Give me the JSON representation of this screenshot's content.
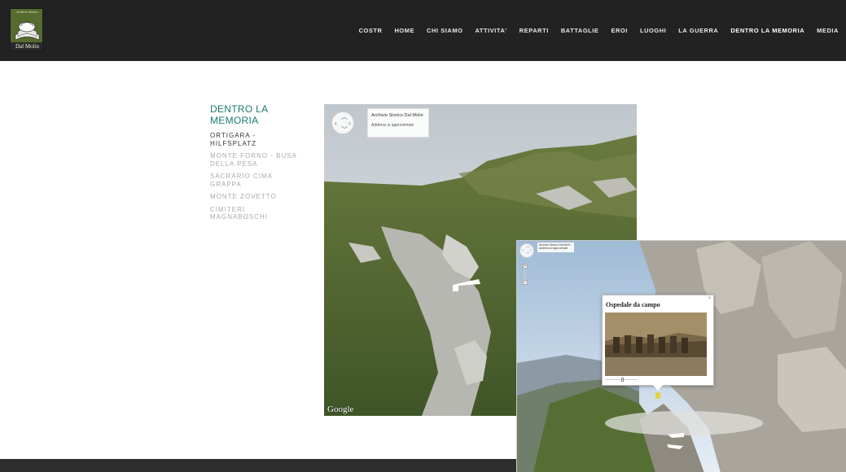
{
  "header": {
    "logo": {
      "top_text": "Archivio Storico",
      "bottom_text": "Dal Molin"
    },
    "nav": [
      {
        "label": "COSTR",
        "active": false
      },
      {
        "label": "HOME",
        "active": false
      },
      {
        "label": "CHI SIAMO",
        "active": false
      },
      {
        "label": "ATTIVITA'",
        "active": false
      },
      {
        "label": "REPARTI",
        "active": false
      },
      {
        "label": "BATTAGLIE",
        "active": false
      },
      {
        "label": "EROI",
        "active": false
      },
      {
        "label": "LUOGHI",
        "active": false
      },
      {
        "label": "LA GUERRA",
        "active": false
      },
      {
        "label": "DENTRO LA MEMORIA",
        "active": true
      },
      {
        "label": "MEDIA",
        "active": false
      }
    ]
  },
  "sidebar": {
    "title": "DENTRO LA MEMORIA",
    "items": [
      {
        "label": "ORTIGARA - HILFSPLATZ",
        "current": true
      },
      {
        "label": "MONTE FORNO - BUSA DELLA PESA",
        "current": false
      },
      {
        "label": "SACRARIO CIMA GRAPPA",
        "current": false
      },
      {
        "label": "MONTE ZOVETTO",
        "current": false
      },
      {
        "label": "CIMITERI MAGNABOSCHI",
        "current": false
      }
    ]
  },
  "panorama_main": {
    "card_title": "Archivio Storico Dal Molin",
    "card_address": "Address is approximate",
    "google_label": "Google"
  },
  "panorama_secondary": {
    "card_title": "Archivio Storico Dal Molin",
    "card_address": "Address is approximate",
    "popup_title": "Ospedale da campo",
    "popup_close": "×"
  },
  "icons": {
    "nav_control": "pan-control-icon",
    "zoom_in": "plus-icon",
    "zoom_out": "minus-icon",
    "close": "close-icon",
    "arrow": "navigation-arrow-icon"
  },
  "colors": {
    "header_bg": "#222222",
    "accent": "#1a7a6d",
    "inactive_text": "#a9a9a9",
    "footer_bg": "#2d2d2d"
  }
}
